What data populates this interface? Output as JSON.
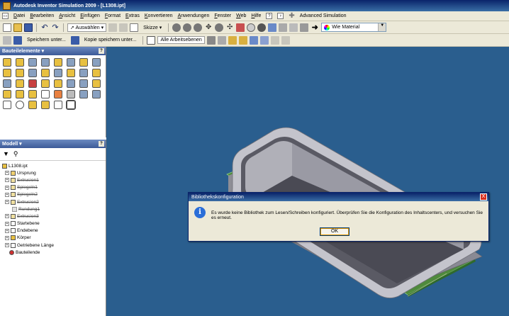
{
  "window": {
    "title": "Autodesk Inventor Simulation 2009 - [L1308.ipt]"
  },
  "menu": [
    "Datei",
    "Bearbeiten",
    "Ansicht",
    "Einfügen",
    "Format",
    "Extras",
    "Konvertieren",
    "Anwendungen",
    "Fenster",
    "Web",
    "Hilfe",
    "Advanced Simulation"
  ],
  "toolbar1": {
    "select_label": "Auswählen",
    "sketch_label": "Skizze",
    "material_value": "Wie Material"
  },
  "toolbar2": {
    "save_under": "Speichern unter...",
    "save_copy": "Kopie speichern unter...",
    "all_workplanes": "Alle Arbeitsebenen"
  },
  "features_panel": {
    "title": "Bauteilelemente ▾",
    "help": "?"
  },
  "model_panel": {
    "title": "Modell ▾",
    "help": "?",
    "root": "L1308.ipt",
    "items": [
      {
        "label": "Ursprung",
        "suppressed": false
      },
      {
        "label": "Extrusion1",
        "suppressed": true
      },
      {
        "label": "Spiegeln1",
        "suppressed": true
      },
      {
        "label": "Spiegeln2",
        "suppressed": true
      },
      {
        "label": "Extrusion2",
        "suppressed": true
      },
      {
        "label": "Rundung1",
        "suppressed": true
      },
      {
        "label": "Extrusion3",
        "suppressed": true
      },
      {
        "label": "Startebene",
        "suppressed": false
      },
      {
        "label": "Endebene",
        "suppressed": false
      },
      {
        "label": "Körper",
        "suppressed": false
      },
      {
        "label": "Getriebene Länge",
        "suppressed": false
      },
      {
        "label": "Bauteilende",
        "suppressed": false
      }
    ]
  },
  "dialog": {
    "title": "Bibliothekskonfiguration",
    "message": "Es wurde keine Bibliothek zum Lesen/Schreiben konfiguriert. Überprüfen Sie die Konfiguration des Inhaltscenters, und versuchen Sie es erneut.",
    "ok_label": "OK",
    "close_label": "X"
  }
}
